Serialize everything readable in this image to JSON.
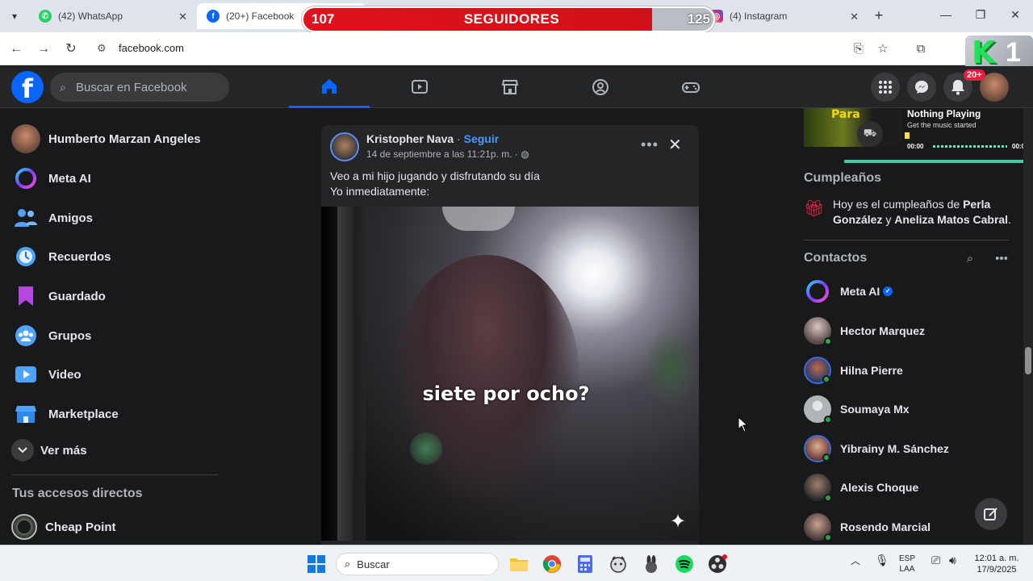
{
  "browser": {
    "tabs": [
      {
        "title": "(42) WhatsApp",
        "icon": "whatsapp-icon",
        "color": "#25d366"
      },
      {
        "title": "(20+) Facebook",
        "icon": "facebook-icon",
        "color": "#0866ff"
      },
      {
        "title": "(4) Instagram",
        "icon": "instagram-icon",
        "color": "#d62976"
      }
    ],
    "url": "facebook.com"
  },
  "overlay": {
    "followers_left": "107",
    "followers_label": "SEGUIDORES",
    "followers_right": "125",
    "logo_letter": "K",
    "logo_number": "1"
  },
  "fb": {
    "search_placeholder": "Buscar en Facebook",
    "notification_badge": "20+",
    "sidebar": [
      {
        "label": "Humberto Marzan Angeles",
        "icon": "profile-avatar"
      },
      {
        "label": "Meta AI",
        "icon": "meta-ai-icon"
      },
      {
        "label": "Amigos",
        "icon": "friends-icon"
      },
      {
        "label": "Recuerdos",
        "icon": "memories-icon"
      },
      {
        "label": "Guardado",
        "icon": "saved-icon"
      },
      {
        "label": "Grupos",
        "icon": "groups-icon"
      },
      {
        "label": "Video",
        "icon": "video-icon"
      },
      {
        "label": "Marketplace",
        "icon": "marketplace-icon"
      },
      {
        "label": "Ver más",
        "icon": "chevron-down-icon"
      }
    ],
    "shortcuts_title": "Tus accesos directos",
    "shortcuts": [
      {
        "label": "Cheap Point"
      }
    ],
    "post": {
      "author": "Kristopher Nava",
      "follow": "Seguir",
      "separator": "·",
      "timestamp": "14 de septiembre a las 11:21p. m. ·",
      "text_line1": "Veo a mi hijo jugando y disfrutando su día",
      "text_line2": "Yo inmediatamente:",
      "video_caption": "siete por ocho?"
    },
    "music": {
      "title": "Nothing Playing",
      "subtitle": "Get the music started",
      "time_start": "00:00",
      "time_end": "00:00"
    },
    "birthdays_title": "Cumpleaños",
    "birthday_prefix": "Hoy es el cumpleaños de ",
    "birthday_name1": "Perla González",
    "birthday_and": " y ",
    "birthday_name2": "Aneliza Matos Cabral",
    "birthday_suffix": ".",
    "contacts_title": "Contactos",
    "contacts": [
      {
        "name": "Meta AI",
        "verified": true
      },
      {
        "name": "Hector Marquez",
        "online": true
      },
      {
        "name": "Hilna Pierre",
        "online": true
      },
      {
        "name": "Soumaya Mx",
        "online": true
      },
      {
        "name": "Yibrainy M. Sánchez",
        "online": true
      },
      {
        "name": "Alexis Choque",
        "online": true
      },
      {
        "name": "Rosendo Marcial",
        "online": true
      }
    ]
  },
  "taskbar": {
    "search": "Buscar",
    "lang_line1": "ESP",
    "lang_line2": "LAA",
    "time": "12:01 a. m.",
    "date": "17/9/2025"
  },
  "colors": {
    "fb_blue": "#0866ff",
    "fb_bg": "#18191a",
    "fb_card": "#242526",
    "online_green": "#31a24c",
    "overlay_red": "#e0121b"
  }
}
